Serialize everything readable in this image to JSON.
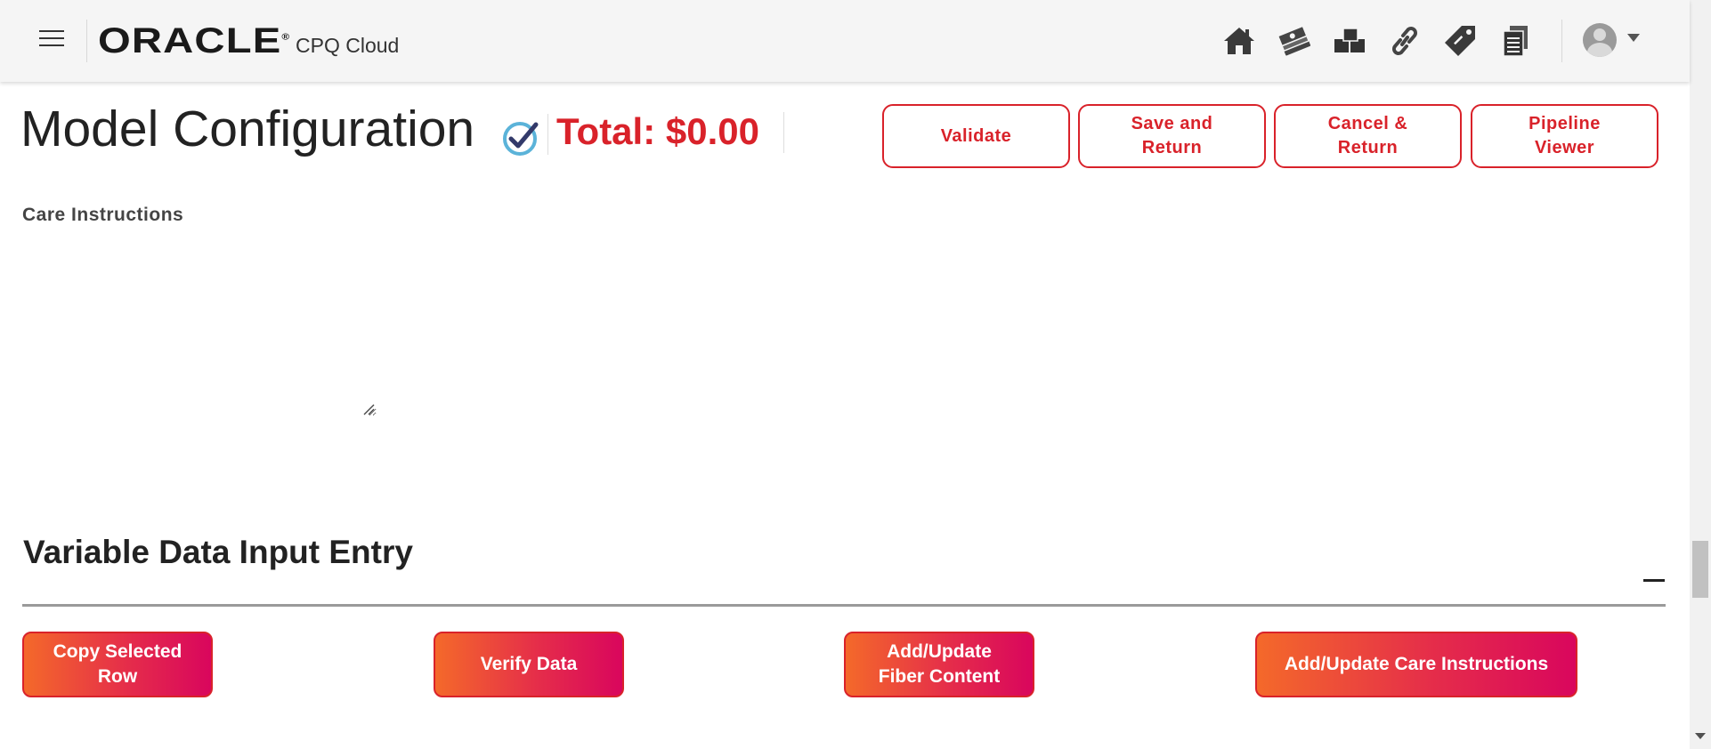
{
  "app": {
    "brand": "ORACLE",
    "brand_mark": "®",
    "product": "CPQ Cloud",
    "nav_icons": [
      "home-icon",
      "money-icon",
      "blocks-icon",
      "link-icon",
      "tag-icon",
      "documents-icon"
    ]
  },
  "header": {
    "title": "Model Configuration",
    "total": "Total: $0.00",
    "buttons": [
      {
        "label": "Validate"
      },
      {
        "label": "Save and Return"
      },
      {
        "label": "Cancel & Return"
      },
      {
        "label": "Pipeline Viewer"
      }
    ]
  },
  "care": {
    "label": "Care Instructions",
    "value": ""
  },
  "section": {
    "title": "Variable Data Input Entry",
    "collapse_symbol": "—",
    "actions": [
      {
        "label": "Copy Selected Row"
      },
      {
        "label": "Verify Data"
      },
      {
        "label": "Add/Update Fiber Content"
      },
      {
        "label": "Add/Update Care Instructions"
      }
    ]
  },
  "colors": {
    "accent": "#d9222a",
    "gradient_start": "#f4692a",
    "gradient_end": "#d9065d",
    "topbar_bg": "#f5f5f5"
  }
}
